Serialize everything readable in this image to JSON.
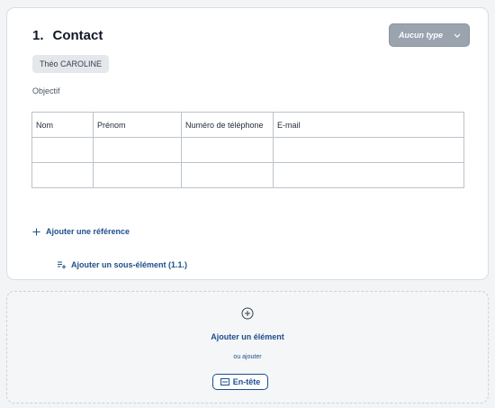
{
  "section": {
    "number": "1.",
    "title": "Contact",
    "type_select": "Aucun type",
    "person_tag": "Théo CAROLINE",
    "objective_label": "Objectif"
  },
  "table": {
    "headers": [
      "Nom",
      "Prénom",
      "Numéro de téléphone",
      "E-mail"
    ],
    "rows": [
      [
        "",
        "",
        "",
        ""
      ],
      [
        "",
        "",
        "",
        ""
      ]
    ]
  },
  "actions": {
    "add_reference": "Ajouter une référence",
    "add_sub_element": "Ajouter un sous-élément (1.1.)"
  },
  "add_zone": {
    "add_element": "Ajouter un élément",
    "or_add": "ou ajouter",
    "header_button": "En-tête"
  },
  "colors": {
    "link": "#1e4e8c",
    "select_bg": "#9aa3ae"
  },
  "icons": {
    "chevron": "chevron-down-icon",
    "plus": "plus-icon",
    "sub_element": "add-sub-element-icon",
    "add_circle": "plus-circle-icon",
    "header": "header-icon"
  }
}
